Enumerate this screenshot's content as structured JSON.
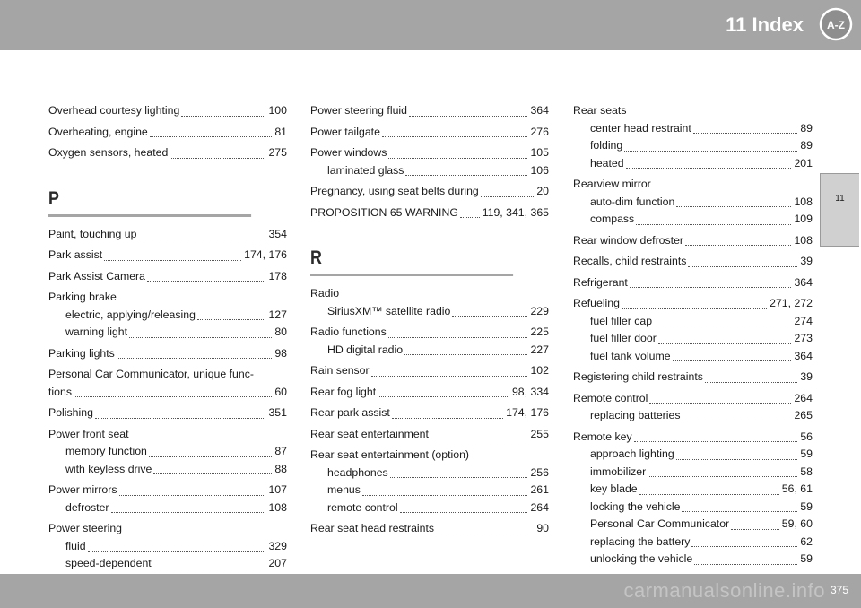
{
  "header": {
    "title": "11 Index",
    "icon_text": "A-Z"
  },
  "side_tab": {
    "label": "11"
  },
  "footer": {
    "page_number": "375",
    "watermark": "carmanualsonline.info"
  },
  "columns": [
    [
      {
        "type": "line",
        "label": "Overhead courtesy lighting",
        "page": "100"
      },
      {
        "type": "line",
        "label": "Overheating, engine",
        "page": "81"
      },
      {
        "type": "line",
        "label": "Oxygen sensors, heated",
        "page": "275"
      },
      {
        "type": "letter",
        "label": "P"
      },
      {
        "type": "line",
        "label": "Paint, touching up",
        "page": "354"
      },
      {
        "type": "line",
        "label": "Park assist",
        "page": "174, 176"
      },
      {
        "type": "line",
        "label": "Park Assist Camera",
        "page": "178"
      },
      {
        "type": "group",
        "label": "Parking brake",
        "subs": [
          {
            "label": "electric, applying/releasing",
            "page": "127"
          },
          {
            "label": "warning light",
            "page": "80"
          }
        ]
      },
      {
        "type": "line",
        "label": "Parking lights",
        "page": "98"
      },
      {
        "type": "wrap",
        "label": "Personal Car Communicator, unique func-",
        "label2": "tions",
        "page": "60"
      },
      {
        "type": "line",
        "label": "Polishing",
        "page": "351"
      },
      {
        "type": "group",
        "label": "Power front seat",
        "subs": [
          {
            "label": "memory function",
            "page": "87"
          },
          {
            "label": "with keyless drive",
            "page": "88"
          }
        ]
      },
      {
        "type": "group",
        "label": "Power mirrors",
        "page": "107",
        "subs": [
          {
            "label": "defroster",
            "page": "108"
          }
        ]
      },
      {
        "type": "group",
        "label": "Power steering",
        "subs": [
          {
            "label": "fluid",
            "page": "329"
          },
          {
            "label": "speed-dependent",
            "page": "207"
          }
        ]
      }
    ],
    [
      {
        "type": "line",
        "label": "Power steering fluid",
        "page": "364"
      },
      {
        "type": "line",
        "label": "Power tailgate",
        "page": "276"
      },
      {
        "type": "group",
        "label": "Power windows",
        "page": "105",
        "subs": [
          {
            "label": "laminated glass",
            "page": "106"
          }
        ]
      },
      {
        "type": "line",
        "label": "Pregnancy, using seat belts during",
        "page": "20"
      },
      {
        "type": "line",
        "label": "PROPOSITION 65 WARNING",
        "page": "119, 341, 365"
      },
      {
        "type": "letter",
        "label": "R"
      },
      {
        "type": "group",
        "label": "Radio",
        "subs": [
          {
            "label": "SiriusXM™ satellite radio",
            "page": "229"
          }
        ]
      },
      {
        "type": "group",
        "label": "Radio functions",
        "page": "225",
        "subs": [
          {
            "label": "HD digital radio",
            "page": "227"
          }
        ]
      },
      {
        "type": "line",
        "label": "Rain sensor",
        "page": "102"
      },
      {
        "type": "line",
        "label": "Rear fog light",
        "page": "98, 334"
      },
      {
        "type": "line",
        "label": "Rear park assist",
        "page": "174, 176"
      },
      {
        "type": "line",
        "label": "Rear seat entertainment",
        "page": "255"
      },
      {
        "type": "group",
        "label": "Rear seat entertainment (option)",
        "subs": [
          {
            "label": "headphones",
            "page": "256"
          },
          {
            "label": "menus",
            "page": "261"
          },
          {
            "label": "remote control",
            "page": "264"
          }
        ]
      },
      {
        "type": "line",
        "label": "Rear seat head restraints",
        "page": "90"
      }
    ],
    [
      {
        "type": "group",
        "label": "Rear seats",
        "subs": [
          {
            "label": "center head restraint",
            "page": "89"
          },
          {
            "label": "folding",
            "page": "89"
          },
          {
            "label": "heated",
            "page": "201"
          }
        ]
      },
      {
        "type": "group",
        "label": "Rearview mirror",
        "subs": [
          {
            "label": "auto-dim function",
            "page": "108"
          },
          {
            "label": "compass",
            "page": "109"
          }
        ]
      },
      {
        "type": "line",
        "label": "Rear window defroster",
        "page": "108"
      },
      {
        "type": "line",
        "label": "Recalls, child restraints",
        "page": "39"
      },
      {
        "type": "line",
        "label": "Refrigerant",
        "page": "364"
      },
      {
        "type": "group",
        "label": "Refueling",
        "page": "271, 272",
        "subs": [
          {
            "label": "fuel filler cap",
            "page": "274"
          },
          {
            "label": "fuel filler door",
            "page": "273"
          },
          {
            "label": "fuel tank volume",
            "page": "364"
          }
        ]
      },
      {
        "type": "line",
        "label": "Registering child restraints",
        "page": "39"
      },
      {
        "type": "group",
        "label": "Remote control",
        "page": "264",
        "subs": [
          {
            "label": "replacing batteries",
            "page": "265"
          }
        ]
      },
      {
        "type": "group",
        "label": "Remote key",
        "page": "56",
        "subs": [
          {
            "label": "approach lighting",
            "page": "59"
          },
          {
            "label": "immobilizer",
            "page": "58"
          },
          {
            "label": "key blade",
            "page": "56, 61"
          },
          {
            "label": "locking the vehicle",
            "page": "59"
          },
          {
            "label": "Personal Car Communicator",
            "page": "59, 60"
          },
          {
            "label": "replacing the battery",
            "page": "62"
          },
          {
            "label": "unlocking the vehicle",
            "page": "59"
          }
        ]
      }
    ]
  ]
}
